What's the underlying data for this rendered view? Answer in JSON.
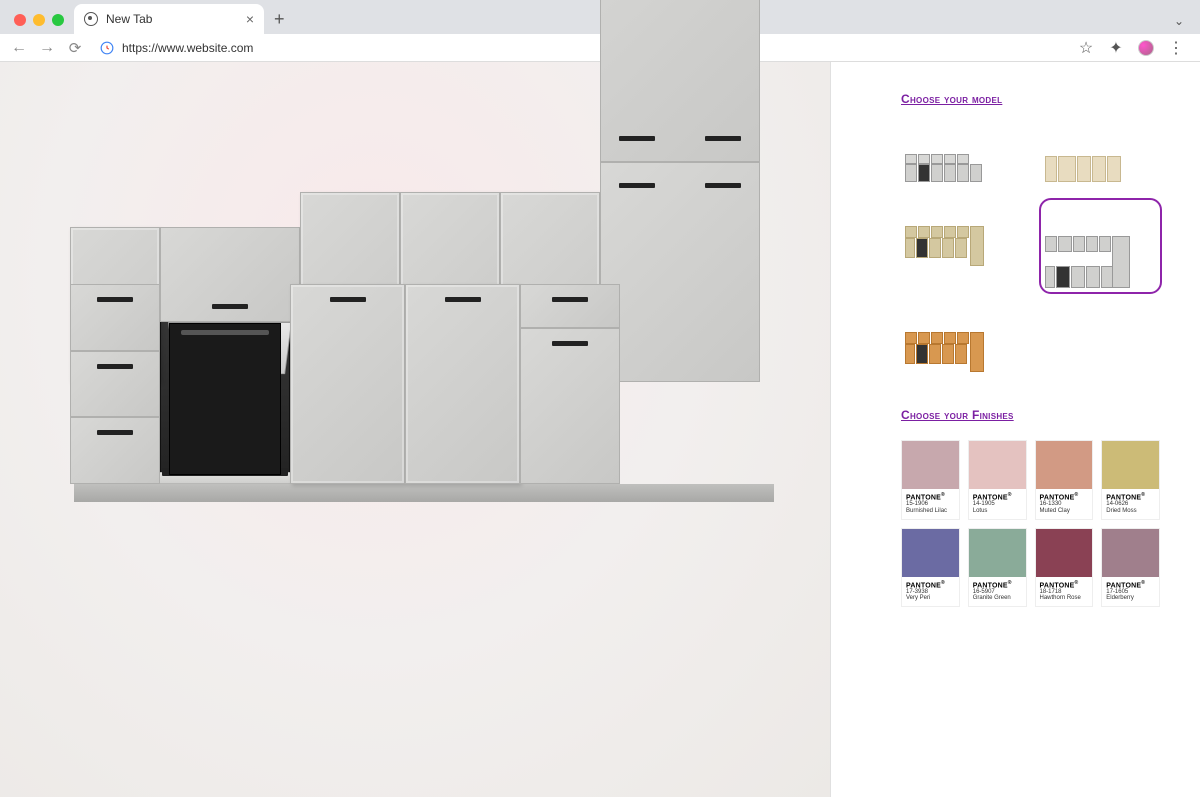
{
  "browser": {
    "tab_title": "New Tab",
    "url": "https://www.website.com"
  },
  "sidebar": {
    "section_model": "Choose your model",
    "section_finishes": "Choose your Finishes",
    "models": [
      {
        "id": "model-1",
        "selected": false
      },
      {
        "id": "model-2",
        "selected": false
      },
      {
        "id": "model-3",
        "selected": false
      },
      {
        "id": "model-4",
        "selected": true
      },
      {
        "id": "model-5",
        "selected": false
      }
    ],
    "finishes": [
      {
        "brand": "PANTONE",
        "code": "15-1906",
        "name": "Burnished Lilac",
        "color": "#c7a8ad"
      },
      {
        "brand": "PANTONE",
        "code": "14-1905",
        "name": "Lotus",
        "color": "#e4c2c0"
      },
      {
        "brand": "PANTONE",
        "code": "16-1330",
        "name": "Muted Clay",
        "color": "#d29a84"
      },
      {
        "brand": "PANTONE",
        "code": "14-0626",
        "name": "Dried Moss",
        "color": "#ccbb77"
      },
      {
        "brand": "PANTONE",
        "code": "17-3938",
        "name": "Very Peri",
        "color": "#6b6ba3"
      },
      {
        "brand": "PANTONE",
        "code": "16-5907",
        "name": "Granite Green",
        "color": "#8aab99"
      },
      {
        "brand": "PANTONE",
        "code": "18-1718",
        "name": "Hawthorn Rose",
        "color": "#8a4154"
      },
      {
        "brand": "PANTONE",
        "code": "17-1605",
        "name": "Elderberry",
        "color": "#a07f8c"
      }
    ]
  }
}
